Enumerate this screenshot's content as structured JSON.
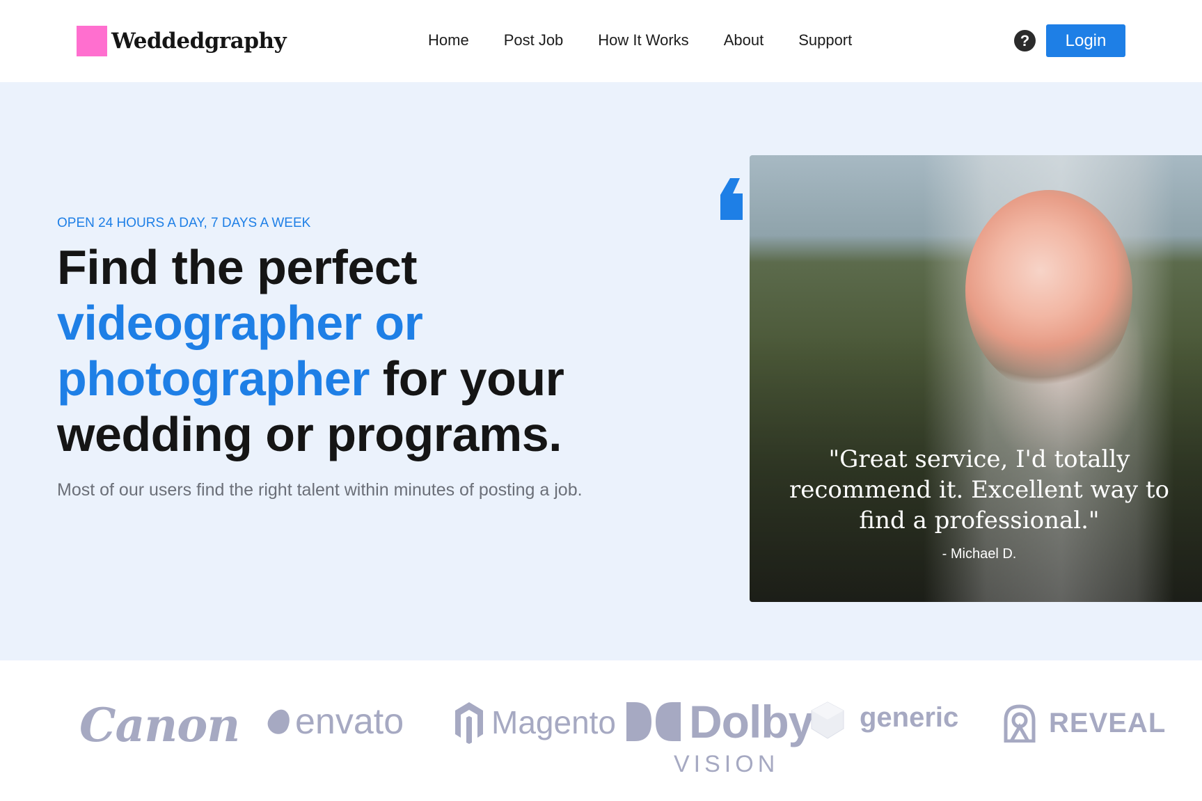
{
  "header": {
    "brand_name": "Weddedgraphy",
    "nav": [
      "Home",
      "Post Job",
      "How It Works",
      "About",
      "Support"
    ],
    "help_symbol": "?",
    "login_label": "Login"
  },
  "hero": {
    "eyebrow": "OPEN 24 HOURS A DAY, 7 DAYS A WEEK",
    "headline_part1": "Find the perfect",
    "headline_accent_line1": "videographer or",
    "headline_accent_line2": "photographer",
    "headline_part2": " for your",
    "headline_part3": "wedding or programs.",
    "subtext": "Most of our users find the right talent within minutes of posting a job.",
    "testimonial": {
      "quote": "\"Great service, I'd totally recommend it. Excellent way to find a professional.\"",
      "author": "- Michael D."
    }
  },
  "brands": {
    "canon": "Canon",
    "envato": "envato",
    "magento": "Magento",
    "dolby": "Dolby",
    "dolby_sub": "VISION",
    "generic": "generic",
    "reveal": "REVEAL"
  },
  "colors": {
    "accent": "#1e7fe6",
    "logo_mark": "#ff6fcf",
    "hero_bg": "#ebf2fc",
    "brand_gray": "#a6a9c2"
  }
}
